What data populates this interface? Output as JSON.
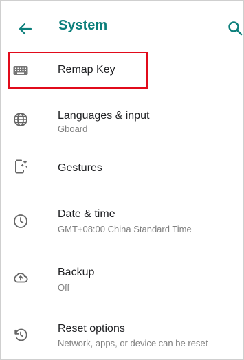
{
  "header": {
    "title": "System",
    "back_icon": "arrow-left-icon",
    "search_icon": "search-icon",
    "accent_color": "#0c7f7b"
  },
  "items": [
    {
      "icon": "keyboard-icon",
      "title": "Remap Key",
      "subtitle": ""
    },
    {
      "icon": "globe-icon",
      "title": "Languages & input",
      "subtitle": "Gboard"
    },
    {
      "icon": "phone-gesture-icon",
      "title": "Gestures",
      "subtitle": ""
    },
    {
      "icon": "clock-icon",
      "title": "Date & time",
      "subtitle": "GMT+08:00 China Standard Time"
    },
    {
      "icon": "cloud-upload-icon",
      "title": "Backup",
      "subtitle": "Off"
    },
    {
      "icon": "history-icon",
      "title": "Reset options",
      "subtitle": "Network, apps, or device can be reset"
    }
  ],
  "highlight_color": "#e10b1b"
}
